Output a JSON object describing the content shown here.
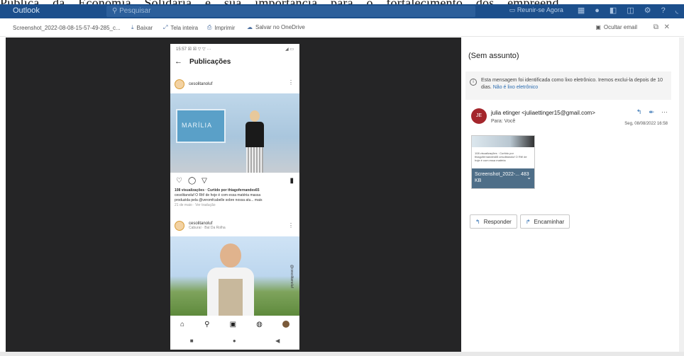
{
  "background_doc": {
    "text": "Pública da Economia Solidária e sua importância para o fortalecimento dos empreend"
  },
  "topbar": {
    "brand": "Outlook",
    "search_placeholder": "Pesquisar",
    "meet": "Reunir-se Agora",
    "icons": [
      "apps-icon",
      "skype-icon",
      "teams-icon",
      "copilot-icon",
      "settings-icon",
      "help-icon",
      "notify-icon"
    ]
  },
  "toolbar": {
    "file_name": "Screenshot_2022-08-08-15-57-49-285_c...",
    "download": "Baixar",
    "fullscreen": "Tela inteira",
    "print": "Imprimir",
    "save_onedrive": "Salvar no OneDrive",
    "hide_email": "Ocultar email"
  },
  "phone": {
    "status_left": "15:57 ☒ ☒ ▽ ▽ ···",
    "status_right": "◢ ▭",
    "title": "Publicações",
    "account1": "cesolitanoluf",
    "post1_screen_text": "MARÍLIA",
    "caption_line1": "108 visualizações · Curtido por thiagofernandes65",
    "caption_line2": "cesolitanoluf O Rtt! de hoje é com essa matéria massa",
    "caption_line3": "produzida pela @veromfcabelle sobre nossa atu... mais",
    "caption_meta": "21 de maio · Ver tradução",
    "account2": "cesolitanoluf",
    "account2_sub": "Caburaí · Bal Da Rolha",
    "post2_watermark": "@cesolitanoluf"
  },
  "email": {
    "subject": "(Sem assunto)",
    "notice": "Esta mensagem foi identificada como lixo eletrônico. Iremos exclui-la depois de 10 dias.",
    "notice_link": "Não é lixo eletrônico",
    "avatar_initials": "JE",
    "from": "julia etinger <juliaettinger15@gmail.com>",
    "to": "Para: Você",
    "date": "Seg, 08/08/2022 16:58",
    "attachment_name": "Screenshot_2022-... 483 KB",
    "attachment_lines": "108 visualizações · Curtido por thiagofernandes65 cesolitanoluf O Rtt! de hoje é com essa matéria",
    "reply": "Responder",
    "forward": "Encaminhar"
  }
}
